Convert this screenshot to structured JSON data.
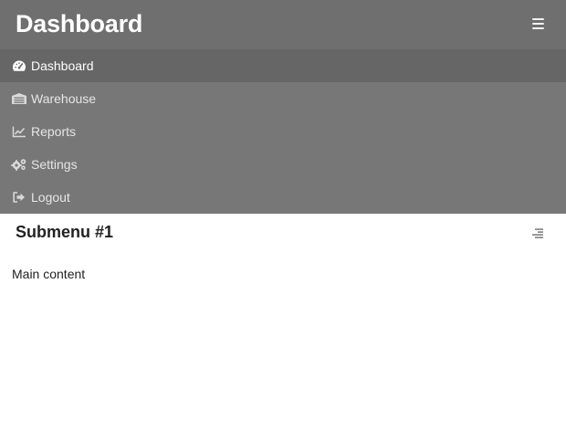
{
  "header": {
    "title": "Dashboard",
    "menu_toggle_icon": "hamburger-icon"
  },
  "sidebar": {
    "items": [
      {
        "label": "Dashboard",
        "icon": "tachometer-icon",
        "active": true
      },
      {
        "label": "Warehouse",
        "icon": "warehouse-icon",
        "active": false
      },
      {
        "label": "Reports",
        "icon": "line-chart-icon",
        "active": false
      },
      {
        "label": "Settings",
        "icon": "gears-icon",
        "active": false
      },
      {
        "label": "Logout",
        "icon": "sign-out-icon",
        "active": false
      }
    ]
  },
  "content": {
    "title": "Submenu #1",
    "toggle_icon": "align-right-icon",
    "main_text": "Main content"
  },
  "colors": {
    "topbar": "#6f6f6f",
    "sidebar": "#777777",
    "sidebar_active": "#666666",
    "content_bg": "#ffffff"
  }
}
